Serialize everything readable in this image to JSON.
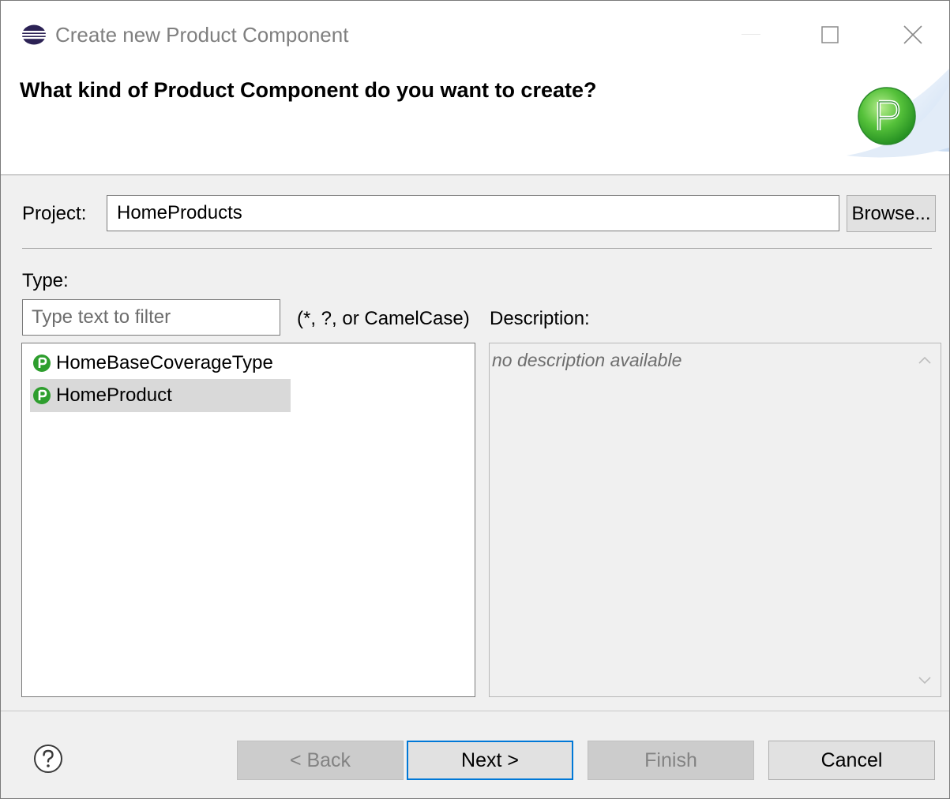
{
  "window": {
    "title": "Create new Product Component"
  },
  "banner": {
    "heading": "What kind of Product Component do you want to create?"
  },
  "project": {
    "label": "Project:",
    "value": "HomeProducts",
    "browse_label": "Browse..."
  },
  "type_section": {
    "label": "Type:",
    "filter_placeholder": "Type text to filter",
    "filter_hint": "(*, ?, or CamelCase)",
    "items": [
      {
        "label": "HomeBaseCoverageType",
        "selected": false
      },
      {
        "label": "HomeProduct",
        "selected": true
      }
    ]
  },
  "description": {
    "label": "Description:",
    "text": "no description available"
  },
  "buttons": {
    "back": "< Back",
    "next": "Next >",
    "finish": "Finish",
    "cancel": "Cancel"
  },
  "colors": {
    "accent": "#0078d7",
    "product_icon": "#2e9e2e"
  }
}
